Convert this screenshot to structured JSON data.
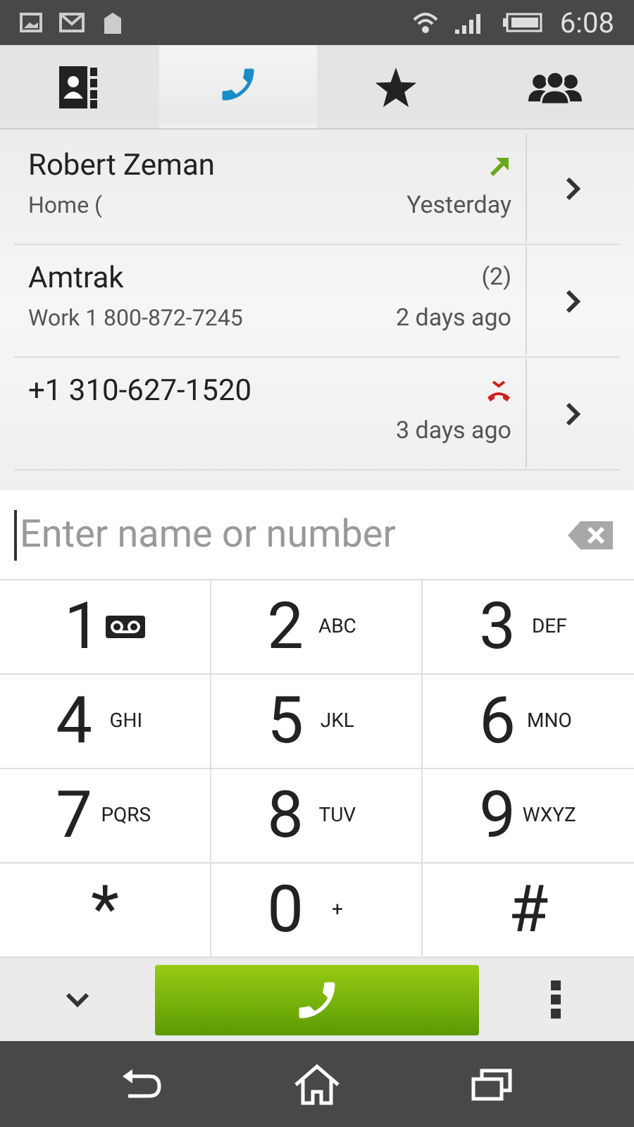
{
  "status_bar": {
    "time": "6:08"
  },
  "tabs": [
    {
      "kind": "contacts",
      "selected": false
    },
    {
      "kind": "phone",
      "selected": true
    },
    {
      "kind": "favorites",
      "selected": false
    },
    {
      "kind": "groups",
      "selected": false
    }
  ],
  "call_log": [
    {
      "name": "Robert Zeman",
      "detail": "Home (",
      "kind": "outgoing",
      "when": "Yesterday"
    },
    {
      "name": "Amtrak",
      "detail": "Work 1 800-872-7245",
      "kind": "count",
      "count": "(2)",
      "when": "2 days ago"
    },
    {
      "name": "+1 310-627-1520",
      "kind": "missed",
      "when": "3 days ago"
    }
  ],
  "search": {
    "placeholder": "Enter name or number"
  },
  "keypad": [
    {
      "digit": "1",
      "kind": "voicemail"
    },
    {
      "digit": "2",
      "letters": "ABC"
    },
    {
      "digit": "3",
      "letters": "DEF"
    },
    {
      "digit": "4",
      "letters": "GHI"
    },
    {
      "digit": "5",
      "letters": "JKL"
    },
    {
      "digit": "6",
      "letters": "MNO"
    },
    {
      "digit": "7",
      "letters": "PQRS"
    },
    {
      "digit": "8",
      "letters": "TUV"
    },
    {
      "digit": "9",
      "letters": "WXYZ"
    },
    {
      "digit": "*"
    },
    {
      "digit": "0",
      "letters": "+"
    },
    {
      "digit": "#"
    }
  ]
}
